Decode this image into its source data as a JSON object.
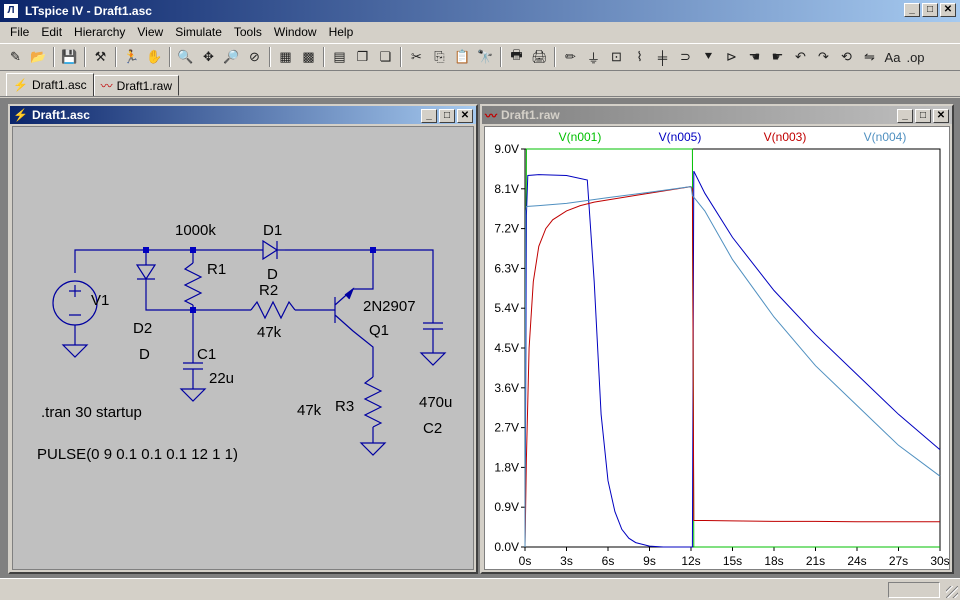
{
  "app": {
    "title": "LTspice IV - Draft1.asc",
    "icon": "ltspice-icon"
  },
  "window_buttons": {
    "minimize": "_",
    "maximize": "□",
    "close": "✕"
  },
  "menu": [
    "File",
    "Edit",
    "Hierarchy",
    "View",
    "Simulate",
    "Tools",
    "Window",
    "Help"
  ],
  "toolbar": [
    {
      "name": "new-schematic-icon",
      "glyph": "✎"
    },
    {
      "name": "open-icon",
      "glyph": "📂"
    },
    {
      "sep": true
    },
    {
      "name": "save-icon",
      "glyph": "💾"
    },
    {
      "sep": true
    },
    {
      "name": "control-panel-icon",
      "glyph": "⚒"
    },
    {
      "sep": true
    },
    {
      "name": "run-icon",
      "glyph": "🏃"
    },
    {
      "name": "halt-icon",
      "glyph": "✋"
    },
    {
      "sep": true
    },
    {
      "name": "zoom-in-icon",
      "glyph": "🔍"
    },
    {
      "name": "pan-icon",
      "glyph": "✥"
    },
    {
      "name": "zoom-out-icon",
      "glyph": "🔎"
    },
    {
      "name": "zoom-fit-icon",
      "glyph": "⊘"
    },
    {
      "sep": true
    },
    {
      "name": "autorange-icon",
      "glyph": "▦"
    },
    {
      "name": "grid-icon",
      "glyph": "▩"
    },
    {
      "sep": true
    },
    {
      "name": "tile-horizontal-icon",
      "glyph": "▤"
    },
    {
      "name": "cascade-icon",
      "glyph": "❐"
    },
    {
      "name": "tile-vertical-icon",
      "glyph": "❏"
    },
    {
      "sep": true
    },
    {
      "name": "cut-icon",
      "glyph": "✂"
    },
    {
      "name": "copy-icon",
      "glyph": "⎘"
    },
    {
      "name": "paste-icon",
      "glyph": "📋"
    },
    {
      "name": "find-icon",
      "glyph": "🔭"
    },
    {
      "sep": true
    },
    {
      "name": "print-setup-icon",
      "glyph": "🖶"
    },
    {
      "name": "print-icon",
      "glyph": "🖨"
    },
    {
      "sep": true
    },
    {
      "name": "wire-icon",
      "glyph": "✏"
    },
    {
      "name": "ground-icon",
      "glyph": "⏚"
    },
    {
      "name": "label-net-icon",
      "glyph": "⊡"
    },
    {
      "name": "resistor-icon",
      "glyph": "⌇"
    },
    {
      "name": "capacitor-icon",
      "glyph": "╪"
    },
    {
      "name": "inductor-icon",
      "glyph": "⊃"
    },
    {
      "name": "diode-icon",
      "glyph": "⯆"
    },
    {
      "name": "component-icon",
      "glyph": "⊳"
    },
    {
      "name": "move-icon",
      "glyph": "☚"
    },
    {
      "name": "drag-icon",
      "glyph": "☛"
    },
    {
      "name": "undo-icon",
      "glyph": "↶"
    },
    {
      "name": "redo-icon",
      "glyph": "↷"
    },
    {
      "name": "rotate-icon",
      "glyph": "⟲"
    },
    {
      "name": "mirror-icon",
      "glyph": "⇋"
    },
    {
      "name": "text-icon",
      "glyph": "Aa"
    },
    {
      "name": "spice-directive-icon",
      "glyph": ".op"
    }
  ],
  "tabs": [
    {
      "label": "Draft1.asc",
      "icon": "schematic-tab-icon",
      "active": true
    },
    {
      "label": "Draft1.raw",
      "icon": "waveform-tab-icon",
      "active": false
    }
  ],
  "schematic_window": {
    "title": "Draft1.asc",
    "labels": {
      "r1_value": "1000k",
      "r1_name": "R1",
      "d1_name": "D1",
      "d1_model": "D",
      "r2_name": "R2",
      "r2_value": "47k",
      "v1_name": "V1",
      "d2_name": "D2",
      "d2_model": "D",
      "c1_name": "C1",
      "c1_value": "22u",
      "q1_model": "2N2907",
      "q1_name": "Q1",
      "r3_value": "47k",
      "r3_name": "R3",
      "c2_value": "470u",
      "c2_name": "C2",
      "tran_directive": ".tran 30 startup",
      "pulse_source": "PULSE(0 9 0.1 0.1 0.1 12 1 1)"
    }
  },
  "waveform_window": {
    "title": "Draft1.raw",
    "colors": {
      "n001": "#00c000",
      "n005": "#0000c0",
      "n003": "#c00000",
      "n004": "#5090c0"
    },
    "chart_data": {
      "type": "line",
      "title": "",
      "xlabel": "",
      "ylabel": "",
      "xlim": [
        0,
        30
      ],
      "ylim": [
        0,
        9
      ],
      "x_ticks": [
        "0s",
        "3s",
        "6s",
        "9s",
        "12s",
        "15s",
        "18s",
        "21s",
        "24s",
        "27s",
        "30s"
      ],
      "y_ticks": [
        "0.0V",
        "0.9V",
        "1.8V",
        "2.7V",
        "3.6V",
        "4.5V",
        "5.4V",
        "6.3V",
        "7.2V",
        "8.1V",
        "9.0V"
      ],
      "series": [
        {
          "name": "V(n001)",
          "color": "#00c000",
          "x": [
            0,
            0.1,
            12.1,
            12.2,
            30
          ],
          "y": [
            0,
            9,
            9,
            0,
            0
          ]
        },
        {
          "name": "V(n005)",
          "color": "#0000c0",
          "x": [
            0,
            0.1,
            0.2,
            1,
            3,
            4.5,
            5,
            5.5,
            6,
            6.5,
            7,
            7.5,
            8,
            9,
            10,
            12,
            12.1,
            12.2,
            13,
            15,
            18,
            21,
            24,
            27,
            30
          ],
          "y": [
            0,
            7.5,
            8.4,
            8.42,
            8.4,
            8.3,
            6.0,
            3.0,
            1.5,
            0.8,
            0.4,
            0.2,
            0.1,
            0.02,
            0.0,
            0.0,
            0.0,
            8.5,
            8.0,
            7.0,
            5.8,
            4.8,
            3.9,
            3.0,
            2.2
          ]
        },
        {
          "name": "V(n003)",
          "color": "#c00000",
          "x": [
            0,
            0.1,
            0.3,
            0.6,
            1,
            1.5,
            2,
            3,
            4,
            5,
            6,
            8,
            10,
            12,
            12.1,
            12.2,
            13,
            15,
            18,
            21,
            24,
            27,
            30
          ],
          "y": [
            0,
            2.0,
            4.5,
            6.0,
            6.8,
            7.2,
            7.4,
            7.6,
            7.72,
            7.8,
            7.85,
            7.95,
            8.05,
            8.15,
            8.1,
            0.6,
            0.6,
            0.59,
            0.58,
            0.58,
            0.57,
            0.57,
            0.57
          ]
        },
        {
          "name": "V(n004)",
          "color": "#5090c0",
          "x": [
            0,
            0.05,
            0.1,
            1,
            3,
            6,
            9,
            12,
            12.1,
            13,
            15,
            18,
            21,
            24,
            27,
            30
          ],
          "y": [
            0,
            7.6,
            7.7,
            7.72,
            7.77,
            7.9,
            8.02,
            8.15,
            7.95,
            7.6,
            6.5,
            5.2,
            4.1,
            3.2,
            2.3,
            1.6
          ]
        }
      ]
    }
  }
}
